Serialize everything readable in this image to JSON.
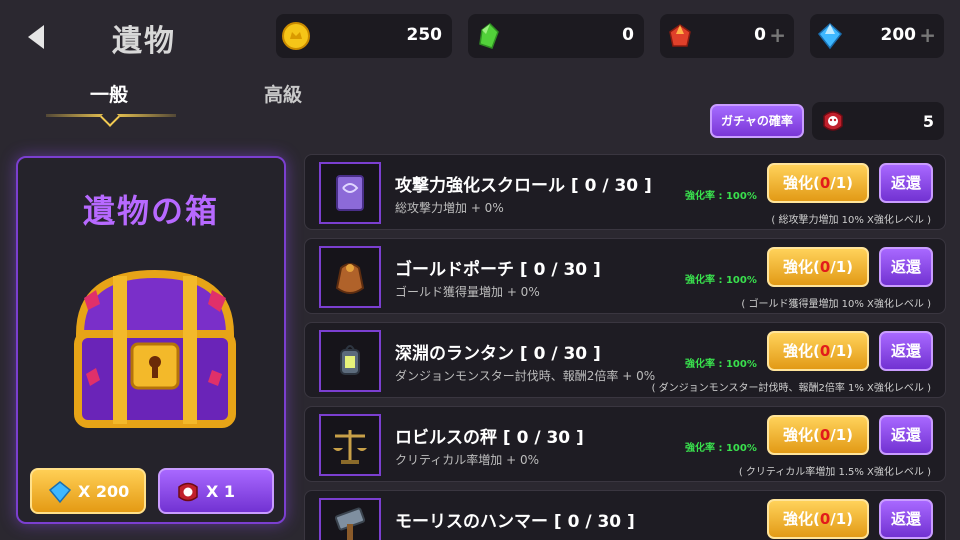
{
  "header": {
    "title": "遺物",
    "back_icon": "back-arrow-icon"
  },
  "currencies": [
    {
      "name": "gold",
      "icon": "gold-coin-icon",
      "value": "250",
      "has_plus": false,
      "color": "#f5c518"
    },
    {
      "name": "green-crystal",
      "icon": "green-crystal-icon",
      "value": "0",
      "has_plus": false,
      "color": "#52d13a"
    },
    {
      "name": "red-gem",
      "icon": "red-gem-icon",
      "value": "0",
      "has_plus": true,
      "plus": "+",
      "color": "#e0402a"
    },
    {
      "name": "blue-diamond",
      "icon": "blue-diamond-icon",
      "value": "200",
      "has_plus": true,
      "plus": "+",
      "color": "#3fb8ff"
    }
  ],
  "tabs": [
    {
      "label": "一般",
      "active": true
    },
    {
      "label": "高級",
      "active": false
    }
  ],
  "gacha": {
    "rate_button": "ガチャの確率",
    "ticket_icon": "relic-ticket-icon",
    "ticket_count": "5"
  },
  "chest": {
    "title": "遺物の箱",
    "icon": "treasure-chest-icon",
    "buy_gem_label": "X 200",
    "buy_gem_icon": "blue-diamond-icon",
    "buy_ticket_label": "X 1",
    "buy_ticket_icon": "relic-ticket-icon"
  },
  "relics": [
    {
      "name": "攻撃力強化スクロール [ 0 / 30 ]",
      "effect": "総攻撃力増加 + 0%",
      "rate": "強化率 : 100%",
      "note": "( 総攻撃力増加 10% X強化レベル )",
      "enhance_pre": "強化(",
      "enhance_cur": "0",
      "enhance_post": "/1)",
      "return": "返還",
      "icon": "scroll-icon"
    },
    {
      "name": "ゴールドポーチ [ 0 / 30 ]",
      "effect": "ゴールド獲得量増加 + 0%",
      "rate": "強化率 : 100%",
      "note": "( ゴールド獲得量増加 10% X強化レベル )",
      "enhance_pre": "強化(",
      "enhance_cur": "0",
      "enhance_post": "/1)",
      "return": "返還",
      "icon": "gold-pouch-icon"
    },
    {
      "name": "深淵のランタン [ 0 / 30 ]",
      "effect": "ダンジョンモンスター討伐時、報酬2倍率 + 0%",
      "rate": "強化率 : 100%",
      "note": "( ダンジョンモンスター討伐時、報酬2倍率 1% X強化レベル )",
      "enhance_pre": "強化(",
      "enhance_cur": "0",
      "enhance_post": "/1)",
      "return": "返還",
      "icon": "lantern-icon"
    },
    {
      "name": "ロビルスの秤 [ 0 / 30 ]",
      "effect": "クリティカル率増加 + 0%",
      "rate": "強化率 : 100%",
      "note": "( クリティカル率増加 1.5% X強化レベル )",
      "enhance_pre": "強化(",
      "enhance_cur": "0",
      "enhance_post": "/1)",
      "return": "返還",
      "icon": "scales-icon"
    },
    {
      "name": "モーリスのハンマー [ 0 / 30 ]",
      "effect": "",
      "rate": "",
      "note": "",
      "enhance_pre": "強化(",
      "enhance_cur": "0",
      "enhance_post": "/1)",
      "return": "返還",
      "icon": "hammer-icon"
    }
  ]
}
